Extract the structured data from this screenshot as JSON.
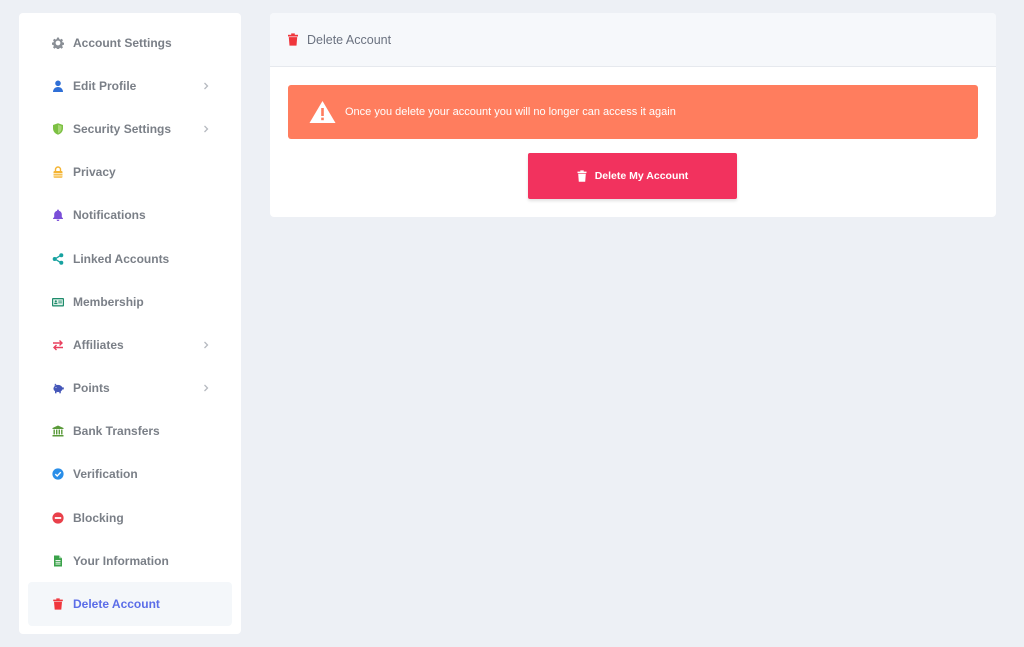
{
  "sidebar": {
    "items": [
      {
        "label": "Account Settings",
        "icon": "gear-icon",
        "color": "#8a8f96"
      },
      {
        "label": "Edit Profile",
        "icon": "user-icon",
        "color": "#2f6fd6"
      },
      {
        "label": "Security Settings",
        "icon": "shield-icon",
        "color": "#7cc043"
      },
      {
        "label": "Privacy",
        "icon": "lock-icon",
        "color": "#f4b433"
      },
      {
        "label": "Notifications",
        "icon": "bell-icon",
        "color": "#7a4fd8"
      },
      {
        "label": "Linked Accounts",
        "icon": "share-icon",
        "color": "#17a2a0"
      },
      {
        "label": "Membership",
        "icon": "id-card-icon",
        "color": "#1f8c6c"
      },
      {
        "label": "Affiliates",
        "icon": "exchange-icon",
        "color": "#e9405e"
      },
      {
        "label": "Points",
        "icon": "piggy-bank-icon",
        "color": "#4456b8"
      },
      {
        "label": "Bank Transfers",
        "icon": "bank-icon",
        "color": "#5a9a3a"
      },
      {
        "label": "Verification",
        "icon": "check-circle-icon",
        "color": "#2a8ee8"
      },
      {
        "label": "Blocking",
        "icon": "minus-circle-icon",
        "color": "#e9404a"
      },
      {
        "label": "Your Information",
        "icon": "document-icon",
        "color": "#3aa24a"
      },
      {
        "label": "Delete Account",
        "icon": "trash-icon",
        "color": "#f0363c"
      }
    ]
  },
  "panel": {
    "title": "Delete Account",
    "title_icon": "trash-icon",
    "alert_text": "Once you delete your account you will no longer can access it again",
    "alert_icon": "warning-icon",
    "button_label": "Delete My Account",
    "button_icon": "trash-icon"
  },
  "colors": {
    "page_bg": "#edf0f5",
    "alert_bg": "#ff7d5e",
    "button_bg": "#f2325e",
    "active_text": "#5b6de8"
  }
}
